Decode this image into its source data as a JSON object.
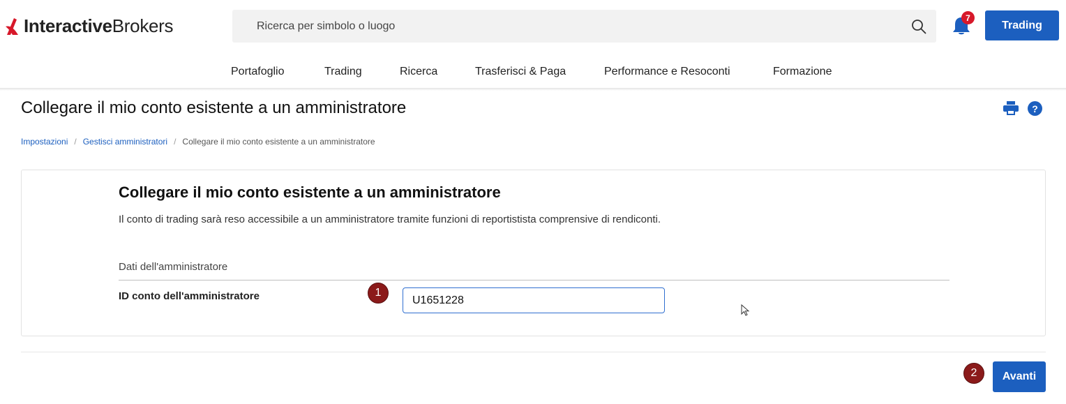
{
  "brand": {
    "name_bold": "Interactive",
    "name_light": "Brokers",
    "accent_color": "#d7182a",
    "primary_color": "#1c5fbf"
  },
  "header": {
    "search_placeholder": "Ricerca per simbolo o luogo",
    "search_icon": "search-icon",
    "notification_count": "7",
    "trading_button": "Trading"
  },
  "nav": {
    "items": [
      {
        "label": "Portafoglio"
      },
      {
        "label": "Trading"
      },
      {
        "label": "Ricerca"
      },
      {
        "label": "Trasferisci & Paga"
      },
      {
        "label": "Performance e Resoconti"
      },
      {
        "label": "Formazione"
      }
    ]
  },
  "page": {
    "title": "Collegare il mio conto esistente a un amministratore",
    "help_glyph": "?",
    "breadcrumb": [
      {
        "label": "Impostazioni"
      },
      {
        "label": "Gestisci amministratori"
      },
      {
        "label": "Collegare il mio conto esistente a un amministratore"
      }
    ],
    "breadcrumb_separator": "/"
  },
  "form": {
    "heading": "Collegare il mio conto esistente a un amministratore",
    "description": "Il conto di trading sarà reso accessibile a un amministratore tramite funzioni di reportistista comprensive di rendiconti.",
    "section_label": "Dati dell'amministratore",
    "field_label": "ID conto dell'amministratore",
    "field_value": "U1651228"
  },
  "steps": {
    "step1": "1",
    "step2": "2"
  },
  "footer": {
    "next_button": "Avanti"
  }
}
